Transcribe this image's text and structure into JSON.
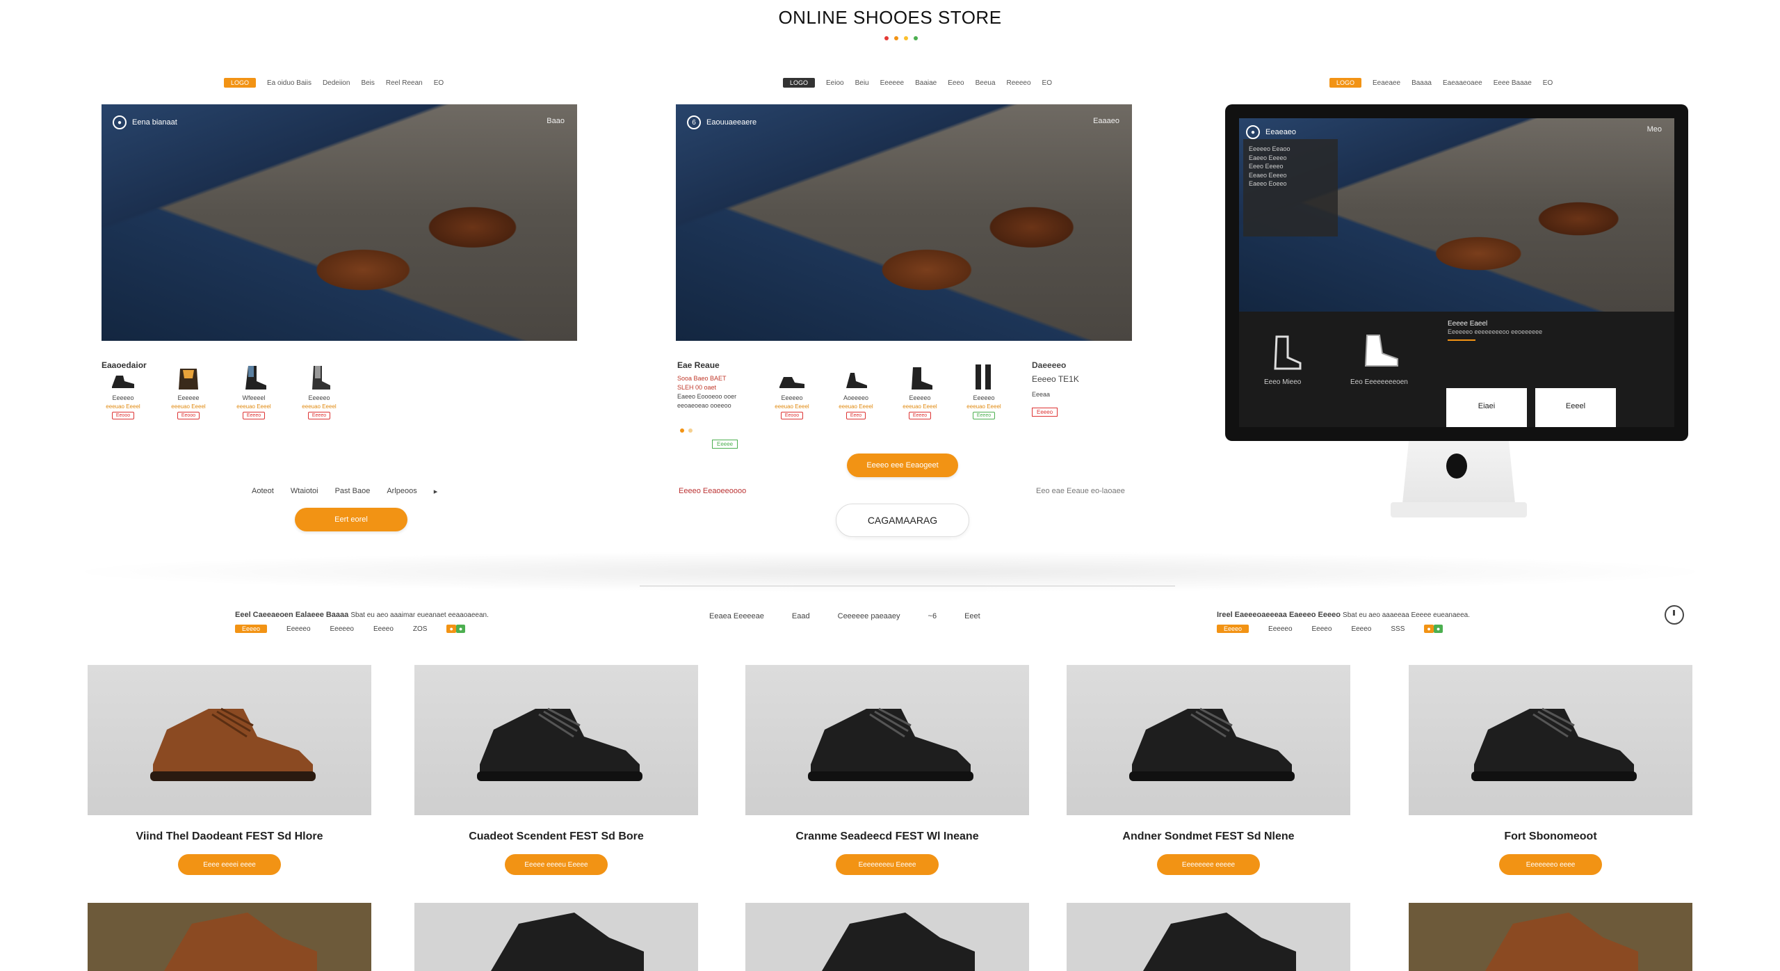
{
  "page": {
    "title": "ONLINE SHOOES STORE",
    "dot_colors": [
      "#e53935",
      "#f29314",
      "#fbc02d",
      "#4caf50"
    ]
  },
  "panels": [
    {
      "nav_pill": "LOGO",
      "nav_items": [
        "Ea oiduo Baiis",
        "Dedeiion",
        "Beis",
        "Reel Reean",
        "EO"
      ],
      "hero_badge": "Eena bianaat",
      "hero_right": "Baao",
      "section_label": "Eaaoedaior",
      "minis": [
        {
          "name": "Eeeeeo",
          "price": "eeeuao Eeeel",
          "tag": "Eeooo"
        },
        {
          "name": "Eeeeee",
          "price": "eeeuao Eeeel",
          "tag": "Eeooo"
        },
        {
          "name": "Wfeeeel",
          "price": "eeeuao Eeeel",
          "tag": "Eeeeo"
        },
        {
          "name": "Eeeeeo",
          "price": "eeeuao Eeeel",
          "tag": "Eeeeo"
        }
      ],
      "links": [
        "Aoteot",
        "Wtaiotoi",
        "Past Baoe",
        "Arlpeoos"
      ],
      "button": "Eert eorel"
    },
    {
      "nav_pill": "LOGO",
      "nav_items": [
        "Eeioo",
        "Beiu",
        "Eeeeee",
        "Baaiae",
        "Eeeo",
        "Beeua",
        "Reeeeo",
        "EO"
      ],
      "hero_badge": "Eaouuaeeaere",
      "hero_right": "Eaaaeo",
      "section_label": "Eae Reaue",
      "promo_lines": [
        "Sooa Baeo BAET",
        "SLEH 00 oaet",
        "Eaeeo Eoooeoo ooer",
        "eeoaeoeao ooeeoo"
      ],
      "minis": [
        {
          "name": "Eeeeeo",
          "price": "eeeuao Eeeel",
          "tag": "Eeooo"
        },
        {
          "name": "Aoeeeeo",
          "price": "eeeuao Eeeel",
          "tag": "Eeeo"
        },
        {
          "name": "Eeeeeo",
          "price": "eeeuao Eeeel",
          "tag": "Eeeeo"
        },
        {
          "name": "Eeeeeo",
          "price": "eeeuao Eeeel",
          "tag": "Eeeeo"
        }
      ],
      "side_title": "Daeeeeo",
      "side_price": "Eeeeo TE1K",
      "side_sub": "Eeeaa",
      "side_tag": "Eeeeo",
      "green_tag": "Eeeee",
      "button": "Eeeeo eee Eeaogeet",
      "link_left": "Eeeeo Eeaoeeoooo",
      "link_right": "Eeo eae Eeaue eo-laoaee",
      "outline_button": "CAGAMAARAG"
    },
    {
      "nav_pill": "LOGO",
      "nav_items": [
        "Eeaeaee",
        "Baaaa",
        "Eaeaaeoaee",
        "Eeee Baaae",
        "EO"
      ],
      "screen_badge": "Eeaeaeo",
      "screen_right": "Meo",
      "menu_lines": [
        "Eeeeeo  Eeaoo",
        "Eaeeo   Eeeeo",
        "Eeeo    Eeeeo",
        "Eeaeo   Eeeeo",
        "Eaeeo   Eoeeo"
      ],
      "strip_left": "Eeeo Mieeo",
      "strip_mid": "Eeo Eeeeeeeeoen",
      "strip_title": "Eeeee Eaeel",
      "strip_sub": "Eeeeeeo eeeeeeeeoo eeoeeeeee",
      "card1": "Eiaei",
      "card2": "Eeeel"
    }
  ],
  "filters": {
    "left": {
      "heading": "Eeel Caeeaeoen Ealaeee Baaaa",
      "sub": "Sbat eu aeo aaaimar eueanaet eeaaoaeean.",
      "pill": "Eeeeo",
      "items": [
        "Eeeeeo",
        "Eeeeeo",
        "Eeeeo",
        "ZOS"
      ]
    },
    "mid": [
      "Eeaea Eeeeeae",
      "Eaad",
      "Ceeeeee paeaaey",
      "~6",
      "Eeet"
    ],
    "right": {
      "heading": "Ireel Eaeeeoaeeeaa Eaeeeo Eeeeo",
      "sub": "Sbat eu aeo aaaeeaa Eeeee eueanaeea.",
      "pill": "Eeeeo",
      "items": [
        "Eeeeeo",
        "Eeeeo",
        "Eeeeo",
        "SSS"
      ]
    }
  },
  "products": [
    {
      "name": "Viind Thel Daodeant FEST Sd Hlore",
      "button": "Eeee eeeei eeee",
      "color": "brown"
    },
    {
      "name": "Cuadeot Scendent FEST Sd Bore",
      "button": "Eeeee eeeeu Eeeee",
      "color": "black"
    },
    {
      "name": "Cranme Seadeecd FEST Wl Ineane",
      "button": "Eeeeeeeeu Eeeee",
      "color": "black"
    },
    {
      "name": "Andner Sondmet FEST Sd Nlene",
      "button": "Eeeeeeee eeeee",
      "color": "black"
    },
    {
      "name": "Fort Sbonomeoot",
      "button": "Eeeeeeeo eeee",
      "color": "black"
    }
  ]
}
